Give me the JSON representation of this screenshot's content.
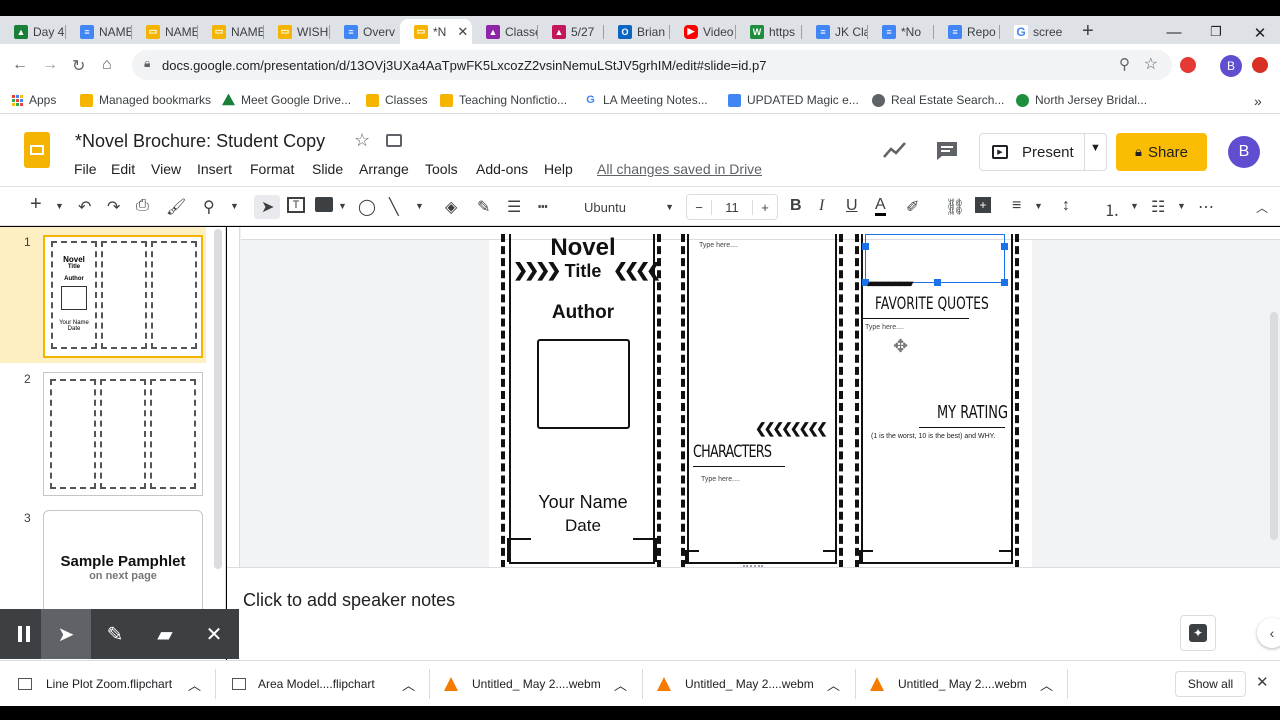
{
  "browser": {
    "tabs": [
      {
        "label": "Day 4",
        "icon": "google-drive-icon",
        "color": "#188038"
      },
      {
        "label": "NAME",
        "icon": "google-docs-icon",
        "color": "#4285f4"
      },
      {
        "label": "NAME",
        "icon": "google-slides-icon",
        "color": "#f4b400"
      },
      {
        "label": "NAME",
        "icon": "google-slides-icon",
        "color": "#f4b400"
      },
      {
        "label": "WISH",
        "icon": "google-slides-icon",
        "color": "#f4b400"
      },
      {
        "label": "Overv",
        "icon": "google-docs-icon",
        "color": "#4285f4"
      },
      {
        "label": "*N",
        "icon": "google-slides-icon",
        "color": "#f4b400"
      },
      {
        "label": "Classe",
        "icon": "google-classroom-icon",
        "color": "#8e24aa"
      },
      {
        "label": "5/27",
        "icon": "google-classroom-icon",
        "color": "#c2185b"
      },
      {
        "label": "Brian",
        "icon": "outlook-icon",
        "color": "#0a66c2"
      },
      {
        "label": "Video",
        "icon": "youtube-icon",
        "color": "#ff0000"
      },
      {
        "label": "https",
        "icon": "web-icon",
        "color": "#1e8e3e"
      },
      {
        "label": "JK Cla",
        "icon": "google-docs-icon",
        "color": "#4285f4"
      },
      {
        "label": "*No",
        "icon": "google-docs-icon",
        "color": "#4285f4"
      },
      {
        "label": "Repo",
        "icon": "google-docs-icon",
        "color": "#4285f4"
      },
      {
        "label": "scree",
        "icon": "google-icon",
        "color": "#4285f4"
      }
    ],
    "new_tab": "+",
    "url": "docs.google.com/presentation/d/13OVj3UXa4AaTpwFK5LxcozZ2vsinNemuLStJV5grhIM/edit#slide=id.p7",
    "bookmarks": [
      {
        "label": "Apps",
        "color": "#ea4335"
      },
      {
        "label": "Managed bookmarks",
        "color": "#f4b400"
      },
      {
        "label": "Meet Google Drive...",
        "color": "#188038"
      },
      {
        "label": "Classes",
        "color": "#f4b400"
      },
      {
        "label": "Teaching Nonfictio...",
        "color": "#f4b400"
      },
      {
        "label": "LA Meeting Notes...",
        "color": "#4285f4"
      },
      {
        "label": "UPDATED Magic e...",
        "color": "#4285f4"
      },
      {
        "label": "Real Estate Search...",
        "color": "#5f6368"
      },
      {
        "label": "North Jersey Bridal...",
        "color": "#1e8e3e"
      }
    ],
    "profile_initial": "B"
  },
  "doc": {
    "title": "*Novel Brochure: Student Copy",
    "menus": [
      "File",
      "Edit",
      "View",
      "Insert",
      "Format",
      "Slide",
      "Arrange",
      "Tools",
      "Add-ons",
      "Help"
    ],
    "saved_status": "All changes saved in Drive",
    "present_label": "Present",
    "share_label": "Share",
    "avatar_initial": "B"
  },
  "toolbar": {
    "font": "Ubuntu",
    "font_size": "11"
  },
  "filmstrip": {
    "slides": [
      {
        "number": "1",
        "selected": true
      },
      {
        "number": "2",
        "selected": false
      },
      {
        "number": "3",
        "selected": false,
        "title": "Sample Pamphlet",
        "subtitle": "on next page"
      }
    ],
    "thumb1": {
      "novel": "Novel",
      "title": "Title",
      "author": "Author",
      "your_name": "Your Name",
      "date": "Date"
    }
  },
  "slide": {
    "novel": "Novel",
    "title": "Title",
    "author": "Author",
    "your_name": "Your Name",
    "date": "Date",
    "type_here": "Type here....",
    "characters": "CHARACTERS",
    "favorite_quotes": "FAVORITE QUOTES",
    "my_rating": "MY RATING",
    "rating_hint": "(1 is the worst, 10 is the best) and WHY."
  },
  "notes": {
    "placeholder": "Click to add speaker notes"
  },
  "downloads": {
    "items": [
      {
        "name": "Line Plot Zoom.flipchart",
        "icon": "flipchart-icon"
      },
      {
        "name": "Area Model....flipchart",
        "icon": "flipchart-icon"
      },
      {
        "name": "Untitled_ May 2....webm",
        "icon": "vlc-icon"
      },
      {
        "name": "Untitled_ May 2....webm",
        "icon": "vlc-icon"
      },
      {
        "name": "Untitled_ May 2....webm",
        "icon": "vlc-icon"
      }
    ],
    "show_all": "Show all"
  }
}
